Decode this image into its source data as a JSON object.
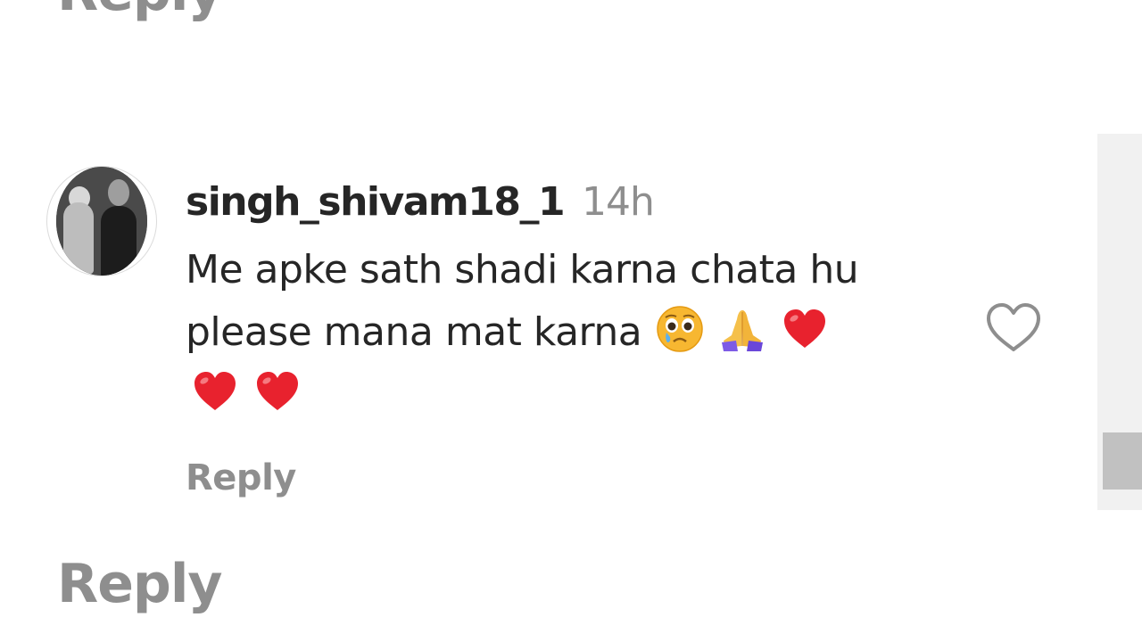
{
  "outer": {
    "reply_top_label": "Reply",
    "reply_bottom_label": "Reply"
  },
  "comment": {
    "username": "singh_shivam18_1",
    "timestamp": "14h",
    "text_line1": "Me apke sath shadi karna chata hu",
    "text_line2": "please mana mat karna",
    "emojis_line2": [
      "crying-face-emoji",
      "praying-hands-emoji",
      "red-heart-emoji"
    ],
    "emojis_line3": [
      "red-heart-emoji",
      "red-heart-emoji"
    ],
    "reply_label": "Reply",
    "like_icon": "heart-outline-icon"
  },
  "colors": {
    "text_primary": "#262626",
    "text_secondary": "#8e8e8e",
    "heart_red": "#e8222e",
    "scrollbar_track": "#f1f1f1",
    "scrollbar_thumb": "#c1c1c1"
  }
}
